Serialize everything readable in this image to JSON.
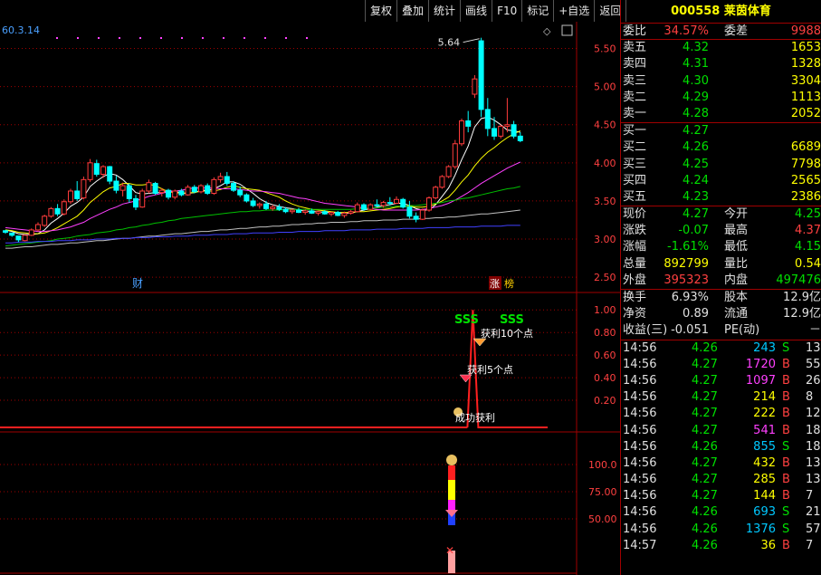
{
  "stock": {
    "code": "000558",
    "name": "莱茵体育"
  },
  "toolbar": [
    "复权",
    "叠加",
    "统计",
    "画线",
    "F10",
    "标记",
    "+自选",
    "返回"
  ],
  "top_label": "60.3.14",
  "peak_label": "5.64",
  "chart_labels": {
    "cai": "财",
    "zhang": "涨",
    "bang": "榜"
  },
  "price_axis": [
    "5.50",
    "5.00",
    "4.50",
    "4.00",
    "3.50",
    "3.00",
    "2.50"
  ],
  "mid_axis": [
    "1.00",
    "0.80",
    "0.60",
    "0.40",
    "0.20"
  ],
  "low_axis": [
    "100.0",
    "75.00",
    "50.00"
  ],
  "signals": {
    "sss1": "SSS",
    "sss2": "SSS",
    "p10": "获利10个点",
    "p5": "获利5个点",
    "success": "成功获利"
  },
  "colors": {
    "up": "#ff3c3c",
    "down": "#00ffff",
    "ma5": "#ffffff",
    "ma10": "#ffff00",
    "ma20": "#ff40ff",
    "ma60": "#00c000",
    "ma120": "#c0c0c0",
    "ma250": "#4040ff"
  },
  "chart_data": {
    "type": "candlestick",
    "ylim": [
      2.3,
      5.85
    ],
    "candles": [
      [
        3.11,
        3.12,
        3.07,
        3.09
      ],
      [
        3.08,
        3.08,
        3.03,
        3.05
      ],
      [
        3.04,
        3.04,
        2.96,
        2.99
      ],
      [
        2.98,
        3.06,
        2.97,
        3.05
      ],
      [
        3.05,
        3.14,
        3.04,
        3.12
      ],
      [
        3.12,
        3.22,
        3.1,
        3.19
      ],
      [
        3.18,
        3.32,
        3.16,
        3.3
      ],
      [
        3.3,
        3.42,
        3.28,
        3.4
      ],
      [
        3.4,
        3.46,
        3.3,
        3.33
      ],
      [
        3.33,
        3.52,
        3.31,
        3.49
      ],
      [
        3.49,
        3.66,
        3.46,
        3.63
      ],
      [
        3.63,
        3.76,
        3.5,
        3.53
      ],
      [
        3.54,
        3.82,
        3.52,
        3.78
      ],
      [
        3.78,
        4.05,
        3.75,
        4.0
      ],
      [
        3.99,
        4.04,
        3.82,
        3.85
      ],
      [
        3.85,
        3.97,
        3.8,
        3.95
      ],
      [
        3.95,
        3.96,
        3.72,
        3.76
      ],
      [
        3.76,
        3.83,
        3.6,
        3.64
      ],
      [
        3.64,
        3.74,
        3.56,
        3.7
      ],
      [
        3.7,
        3.73,
        3.48,
        3.53
      ],
      [
        3.53,
        3.58,
        3.38,
        3.42
      ],
      [
        3.42,
        3.66,
        3.41,
        3.63
      ],
      [
        3.63,
        3.78,
        3.6,
        3.74
      ],
      [
        3.73,
        3.75,
        3.58,
        3.6
      ],
      [
        3.61,
        3.67,
        3.56,
        3.64
      ],
      [
        3.64,
        3.66,
        3.52,
        3.55
      ],
      [
        3.55,
        3.65,
        3.52,
        3.63
      ],
      [
        3.63,
        3.66,
        3.56,
        3.58
      ],
      [
        3.58,
        3.71,
        3.57,
        3.68
      ],
      [
        3.68,
        3.71,
        3.6,
        3.62
      ],
      [
        3.62,
        3.72,
        3.6,
        3.7
      ],
      [
        3.7,
        3.73,
        3.58,
        3.6
      ],
      [
        3.6,
        3.81,
        3.58,
        3.78
      ],
      [
        3.78,
        3.87,
        3.74,
        3.82
      ],
      [
        3.82,
        3.88,
        3.7,
        3.73
      ],
      [
        3.73,
        3.76,
        3.62,
        3.64
      ],
      [
        3.64,
        3.69,
        3.55,
        3.58
      ],
      [
        3.58,
        3.6,
        3.48,
        3.5
      ],
      [
        3.5,
        3.54,
        3.42,
        3.44
      ],
      [
        3.44,
        3.48,
        3.4,
        3.46
      ],
      [
        3.46,
        3.5,
        3.38,
        3.4
      ],
      [
        3.4,
        3.45,
        3.37,
        3.42
      ],
      [
        3.42,
        3.46,
        3.37,
        3.39
      ],
      [
        3.39,
        3.42,
        3.34,
        3.36
      ],
      [
        3.36,
        3.4,
        3.33,
        3.38
      ],
      [
        3.38,
        3.41,
        3.34,
        3.35
      ],
      [
        3.35,
        3.39,
        3.32,
        3.37
      ],
      [
        3.37,
        3.4,
        3.33,
        3.34
      ],
      [
        3.34,
        3.37,
        3.31,
        3.36
      ],
      [
        3.36,
        3.38,
        3.32,
        3.33
      ],
      [
        3.33,
        3.36,
        3.3,
        3.35
      ],
      [
        3.35,
        3.37,
        3.3,
        3.31
      ],
      [
        3.31,
        3.36,
        3.28,
        3.34
      ],
      [
        3.34,
        3.38,
        3.32,
        3.36
      ],
      [
        3.36,
        3.48,
        3.35,
        3.45
      ],
      [
        3.45,
        3.47,
        3.37,
        3.39
      ],
      [
        3.39,
        3.47,
        3.38,
        3.45
      ],
      [
        3.45,
        3.52,
        3.42,
        3.44
      ],
      [
        3.44,
        3.5,
        3.41,
        3.48
      ],
      [
        3.48,
        3.55,
        3.44,
        3.47
      ],
      [
        3.47,
        3.56,
        3.46,
        3.52
      ],
      [
        3.52,
        3.54,
        3.4,
        3.42
      ],
      [
        3.42,
        3.5,
        3.27,
        3.3
      ],
      [
        3.3,
        3.35,
        3.22,
        3.26
      ],
      [
        3.26,
        3.4,
        3.25,
        3.38
      ],
      [
        3.38,
        3.56,
        3.36,
        3.54
      ],
      [
        3.54,
        3.7,
        3.52,
        3.68
      ],
      [
        3.68,
        3.84,
        3.66,
        3.82
      ],
      [
        3.82,
        3.97,
        3.8,
        3.95
      ],
      [
        3.95,
        4.3,
        3.92,
        4.25
      ],
      [
        4.25,
        4.58,
        4.22,
        4.55
      ],
      [
        4.55,
        4.68,
        4.4,
        4.48
      ],
      [
        4.9,
        5.15,
        4.85,
        5.1
      ],
      [
        5.6,
        5.64,
        4.6,
        4.7
      ],
      [
        4.7,
        4.85,
        4.35,
        4.45
      ],
      [
        4.45,
        4.6,
        4.3,
        4.35
      ],
      [
        4.35,
        4.5,
        4.32,
        4.48
      ],
      [
        4.48,
        4.85,
        4.4,
        4.5
      ],
      [
        4.5,
        4.55,
        4.32,
        4.35
      ],
      [
        4.35,
        4.4,
        4.27,
        4.29
      ]
    ],
    "series": [
      {
        "name": "MA5",
        "values": [
          3.12,
          3.1,
          3.07,
          3.06,
          3.06,
          3.07,
          3.12,
          3.21,
          3.27,
          3.34,
          3.43,
          3.48,
          3.55,
          3.69,
          3.76,
          3.82,
          3.86,
          3.84,
          3.78,
          3.7,
          3.61,
          3.59,
          3.6,
          3.61,
          3.61,
          3.63,
          3.63,
          3.6,
          3.6,
          3.61,
          3.64,
          3.64,
          3.66,
          3.7,
          3.75,
          3.75,
          3.72,
          3.66,
          3.6,
          3.53,
          3.48,
          3.45,
          3.43,
          3.41,
          3.4,
          3.38,
          3.37,
          3.36,
          3.36,
          3.35,
          3.35,
          3.34,
          3.34,
          3.34,
          3.36,
          3.38,
          3.4,
          3.42,
          3.44,
          3.45,
          3.47,
          3.47,
          3.44,
          3.4,
          3.38,
          3.38,
          3.45,
          3.56,
          3.67,
          3.84,
          4.04,
          4.22,
          4.47,
          4.58,
          4.6,
          4.56,
          4.5,
          4.43,
          4.42,
          4.4
        ]
      },
      {
        "name": "MA10",
        "values": [
          3.12,
          3.11,
          3.09,
          3.08,
          3.07,
          3.07,
          3.08,
          3.11,
          3.15,
          3.2,
          3.25,
          3.3,
          3.38,
          3.48,
          3.55,
          3.62,
          3.67,
          3.69,
          3.73,
          3.73,
          3.71,
          3.71,
          3.72,
          3.7,
          3.66,
          3.62,
          3.61,
          3.6,
          3.61,
          3.61,
          3.63,
          3.63,
          3.63,
          3.65,
          3.68,
          3.7,
          3.68,
          3.66,
          3.65,
          3.64,
          3.61,
          3.58,
          3.55,
          3.5,
          3.46,
          3.43,
          3.41,
          3.39,
          3.38,
          3.37,
          3.36,
          3.35,
          3.35,
          3.35,
          3.36,
          3.36,
          3.37,
          3.38,
          3.39,
          3.4,
          3.42,
          3.43,
          3.43,
          3.42,
          3.42,
          3.43,
          3.46,
          3.5,
          3.55,
          3.64,
          3.75,
          3.84,
          3.96,
          4.06,
          4.14,
          4.2,
          4.27,
          4.33,
          4.38,
          4.42
        ]
      },
      {
        "name": "MA20",
        "values": [
          3.15,
          3.14,
          3.13,
          3.12,
          3.11,
          3.1,
          3.1,
          3.11,
          3.12,
          3.14,
          3.16,
          3.19,
          3.22,
          3.27,
          3.31,
          3.35,
          3.39,
          3.42,
          3.46,
          3.48,
          3.5,
          3.53,
          3.56,
          3.58,
          3.6,
          3.62,
          3.63,
          3.64,
          3.66,
          3.67,
          3.67,
          3.67,
          3.67,
          3.66,
          3.66,
          3.66,
          3.65,
          3.64,
          3.63,
          3.63,
          3.62,
          3.61,
          3.6,
          3.58,
          3.56,
          3.54,
          3.53,
          3.51,
          3.49,
          3.47,
          3.46,
          3.45,
          3.44,
          3.43,
          3.42,
          3.41,
          3.4,
          3.39,
          3.38,
          3.38,
          3.38,
          3.38,
          3.38,
          3.38,
          3.39,
          3.4,
          3.42,
          3.44,
          3.47,
          3.51,
          3.56,
          3.61,
          3.67,
          3.73,
          3.78,
          3.83,
          3.88,
          3.93,
          3.97,
          4.01
        ]
      },
      {
        "name": "MA60",
        "values": [
          2.91,
          2.92,
          2.93,
          2.94,
          2.95,
          2.96,
          2.97,
          2.98,
          3.0,
          3.01,
          3.02,
          3.04,
          3.05,
          3.06,
          3.08,
          3.09,
          3.1,
          3.12,
          3.13,
          3.15,
          3.16,
          3.18,
          3.19,
          3.21,
          3.22,
          3.24,
          3.25,
          3.27,
          3.28,
          3.29,
          3.3,
          3.31,
          3.32,
          3.33,
          3.34,
          3.35,
          3.36,
          3.36,
          3.37,
          3.37,
          3.38,
          3.38,
          3.38,
          3.39,
          3.39,
          3.39,
          3.39,
          3.39,
          3.39,
          3.39,
          3.39,
          3.39,
          3.39,
          3.39,
          3.4,
          3.4,
          3.41,
          3.41,
          3.42,
          3.42,
          3.43,
          3.43,
          3.44,
          3.44,
          3.45,
          3.46,
          3.47,
          3.48,
          3.5,
          3.51,
          3.53,
          3.54,
          3.56,
          3.58,
          3.6,
          3.62,
          3.64,
          3.66,
          3.67,
          3.69
        ]
      },
      {
        "name": "MA120",
        "values": [
          2.88,
          2.88,
          2.89,
          2.9,
          2.9,
          2.91,
          2.92,
          2.93,
          2.93,
          2.94,
          2.95,
          2.95,
          2.96,
          2.97,
          2.98,
          2.98,
          2.99,
          3.0,
          3.01,
          3.01,
          3.02,
          3.03,
          3.04,
          3.04,
          3.05,
          3.06,
          3.07,
          3.07,
          3.08,
          3.09,
          3.1,
          3.1,
          3.11,
          3.12,
          3.12,
          3.13,
          3.14,
          3.14,
          3.15,
          3.16,
          3.16,
          3.17,
          3.17,
          3.18,
          3.19,
          3.19,
          3.2,
          3.2,
          3.21,
          3.21,
          3.22,
          3.22,
          3.22,
          3.23,
          3.23,
          3.24,
          3.24,
          3.24,
          3.25,
          3.25,
          3.25,
          3.26,
          3.26,
          3.26,
          3.27,
          3.27,
          3.28,
          3.28,
          3.29,
          3.29,
          3.3,
          3.31,
          3.32,
          3.33,
          3.33,
          3.34,
          3.35,
          3.36,
          3.37,
          3.38
        ]
      },
      {
        "name": "MA250",
        "values": [
          2.95,
          2.95,
          2.96,
          2.96,
          2.96,
          2.97,
          2.97,
          2.97,
          2.98,
          2.98,
          2.98,
          2.99,
          2.99,
          2.99,
          3.0,
          3.0,
          3.0,
          3.01,
          3.01,
          3.01,
          3.02,
          3.02,
          3.02,
          3.03,
          3.03,
          3.03,
          3.04,
          3.04,
          3.04,
          3.05,
          3.05,
          3.05,
          3.06,
          3.06,
          3.06,
          3.07,
          3.07,
          3.07,
          3.08,
          3.08,
          3.08,
          3.08,
          3.09,
          3.09,
          3.09,
          3.1,
          3.1,
          3.1,
          3.1,
          3.11,
          3.11,
          3.11,
          3.11,
          3.12,
          3.12,
          3.12,
          3.12,
          3.13,
          3.13,
          3.13,
          3.13,
          3.14,
          3.14,
          3.14,
          3.14,
          3.15,
          3.15,
          3.15,
          3.15,
          3.16,
          3.16,
          3.16,
          3.16,
          3.17,
          3.17,
          3.17,
          3.17,
          3.18,
          3.18,
          3.18
        ]
      }
    ],
    "indicator": {
      "ylim": [
        0,
        1.05
      ],
      "peak_index": 72,
      "peak_value": 1.0,
      "base_value": 0.0
    }
  },
  "quote": {
    "wei_bi_label": "委比",
    "wei_bi": "34.57%",
    "wei_cha_label": "委差",
    "wei_cha": "9988",
    "sell": [
      {
        "label": "卖五",
        "price": "4.32",
        "vol": "1653"
      },
      {
        "label": "卖四",
        "price": "4.31",
        "vol": "1328"
      },
      {
        "label": "卖三",
        "price": "4.30",
        "vol": "3304"
      },
      {
        "label": "卖二",
        "price": "4.29",
        "vol": "1113"
      },
      {
        "label": "卖一",
        "price": "4.28",
        "vol": "2052"
      }
    ],
    "buy": [
      {
        "label": "买一",
        "price": "4.27",
        "vol": ""
      },
      {
        "label": "买二",
        "price": "4.26",
        "vol": "6689"
      },
      {
        "label": "买三",
        "price": "4.25",
        "vol": "7798"
      },
      {
        "label": "买四",
        "price": "4.24",
        "vol": "2565"
      },
      {
        "label": "买五",
        "price": "4.23",
        "vol": "2386"
      }
    ],
    "stats": [
      {
        "l1": "现价",
        "v1": "4.27",
        "c1": "g",
        "l2": "今开",
        "v2": "4.25",
        "c2": "g"
      },
      {
        "l1": "涨跌",
        "v1": "-0.07",
        "c1": "g",
        "l2": "最高",
        "v2": "4.37",
        "c2": "r"
      },
      {
        "l1": "涨幅",
        "v1": "-1.61%",
        "c1": "g",
        "l2": "最低",
        "v2": "4.15",
        "c2": "g"
      },
      {
        "l1": "总量",
        "v1": "892799",
        "c1": "y",
        "l2": "量比",
        "v2": "0.54",
        "c2": "y"
      },
      {
        "l1": "外盘",
        "v1": "395323",
        "c1": "r",
        "l2": "内盘",
        "v2": "497476",
        "c2": "g"
      }
    ],
    "info": [
      {
        "l1": "换手",
        "v1": "6.93%",
        "l2": "股本",
        "v2": "12.9亿"
      },
      {
        "l1": "净资",
        "v1": "0.89",
        "l2": "流通",
        "v2": "12.9亿"
      },
      {
        "l1": "收益(三)",
        "v1": "-0.051",
        "l2": "PE(动)",
        "v2": "－"
      }
    ],
    "ticks": [
      {
        "time": "14:56",
        "price": "4.26",
        "vol": "243",
        "side": "S",
        "n": "13"
      },
      {
        "time": "14:56",
        "price": "4.27",
        "vol": "1720",
        "side": "B",
        "n": "55"
      },
      {
        "time": "14:56",
        "price": "4.27",
        "vol": "1097",
        "side": "B",
        "n": "26"
      },
      {
        "time": "14:56",
        "price": "4.27",
        "vol": "214",
        "side": "B",
        "n": "8"
      },
      {
        "time": "14:56",
        "price": "4.27",
        "vol": "222",
        "side": "B",
        "n": "12"
      },
      {
        "time": "14:56",
        "price": "4.27",
        "vol": "541",
        "side": "B",
        "n": "18"
      },
      {
        "time": "14:56",
        "price": "4.26",
        "vol": "855",
        "side": "S",
        "n": "18"
      },
      {
        "time": "14:56",
        "price": "4.27",
        "vol": "432",
        "side": "B",
        "n": "13"
      },
      {
        "time": "14:56",
        "price": "4.27",
        "vol": "285",
        "side": "B",
        "n": "13"
      },
      {
        "time": "14:56",
        "price": "4.27",
        "vol": "144",
        "side": "B",
        "n": "7"
      },
      {
        "time": "14:56",
        "price": "4.26",
        "vol": "693",
        "side": "S",
        "n": "21"
      },
      {
        "time": "14:56",
        "price": "4.26",
        "vol": "1376",
        "side": "S",
        "n": "57"
      },
      {
        "time": "14:57",
        "price": "4.26",
        "vol": "36",
        "side": "B",
        "n": "7"
      }
    ]
  }
}
